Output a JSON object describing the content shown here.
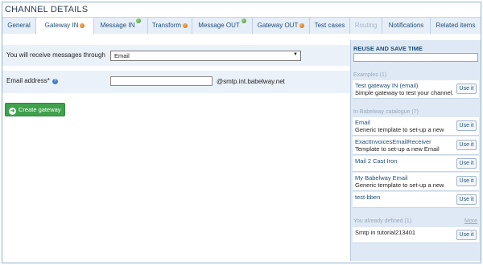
{
  "window": {
    "title": "CHANNEL DETAILS"
  },
  "tabs": [
    {
      "label": "General",
      "status": ""
    },
    {
      "label": "Gateway IN",
      "status": "orange"
    },
    {
      "label": "Message IN",
      "status": "green"
    },
    {
      "label": "Transform",
      "status": "orange"
    },
    {
      "label": "Message OUT",
      "status": "green"
    },
    {
      "label": "Gateway OUT",
      "status": "orange"
    },
    {
      "label": "Test cases",
      "status": ""
    },
    {
      "label": "Routing",
      "status": "disabled"
    },
    {
      "label": "Notifications",
      "status": ""
    },
    {
      "label": "Related items",
      "status": ""
    }
  ],
  "form": {
    "receive_label": "You will receive messages through",
    "receive_value": "Email",
    "email_label": "Email address*",
    "email_value": "",
    "email_domain": "@smtp.int.babelway.net",
    "create_button": "Create gateway"
  },
  "side": {
    "title": "REUSE AND SAVE TIME",
    "search_value": "",
    "examples_header": "Examples (1)",
    "examples": [
      {
        "name": "Test gateway IN (email)",
        "desc": "Simple gateway to test your channel.",
        "btn": "Use it"
      }
    ],
    "catalogue_header": "In Babelway catalogue (7)",
    "catalogue": [
      {
        "name": "Email",
        "desc": "Generic template to set-up a new",
        "btn": "Use it"
      },
      {
        "name": "ExactInvoicesEmailReceiver",
        "desc": "Template to set-up a new Email",
        "btn": "Use it"
      },
      {
        "name": "Mail 2 Cast Iron",
        "desc": "",
        "btn": "Use it"
      },
      {
        "name": "My Babelway Email",
        "desc": "Generic template to set-up a new",
        "btn": "Use it"
      },
      {
        "name": "test-bben",
        "desc": "",
        "btn": "Use it"
      }
    ],
    "defined_header": "You already defined (1)",
    "more_link": "More",
    "defined": [
      {
        "name": "Smtp in tutorial213401",
        "desc": "",
        "btn": "Use it"
      }
    ]
  },
  "colors": {
    "accent": "#1f4e79",
    "panel_bg": "#dfe9f5",
    "button_green": "#3ea14b",
    "status_orange": "#d9791a",
    "status_green": "#4aa83a"
  }
}
